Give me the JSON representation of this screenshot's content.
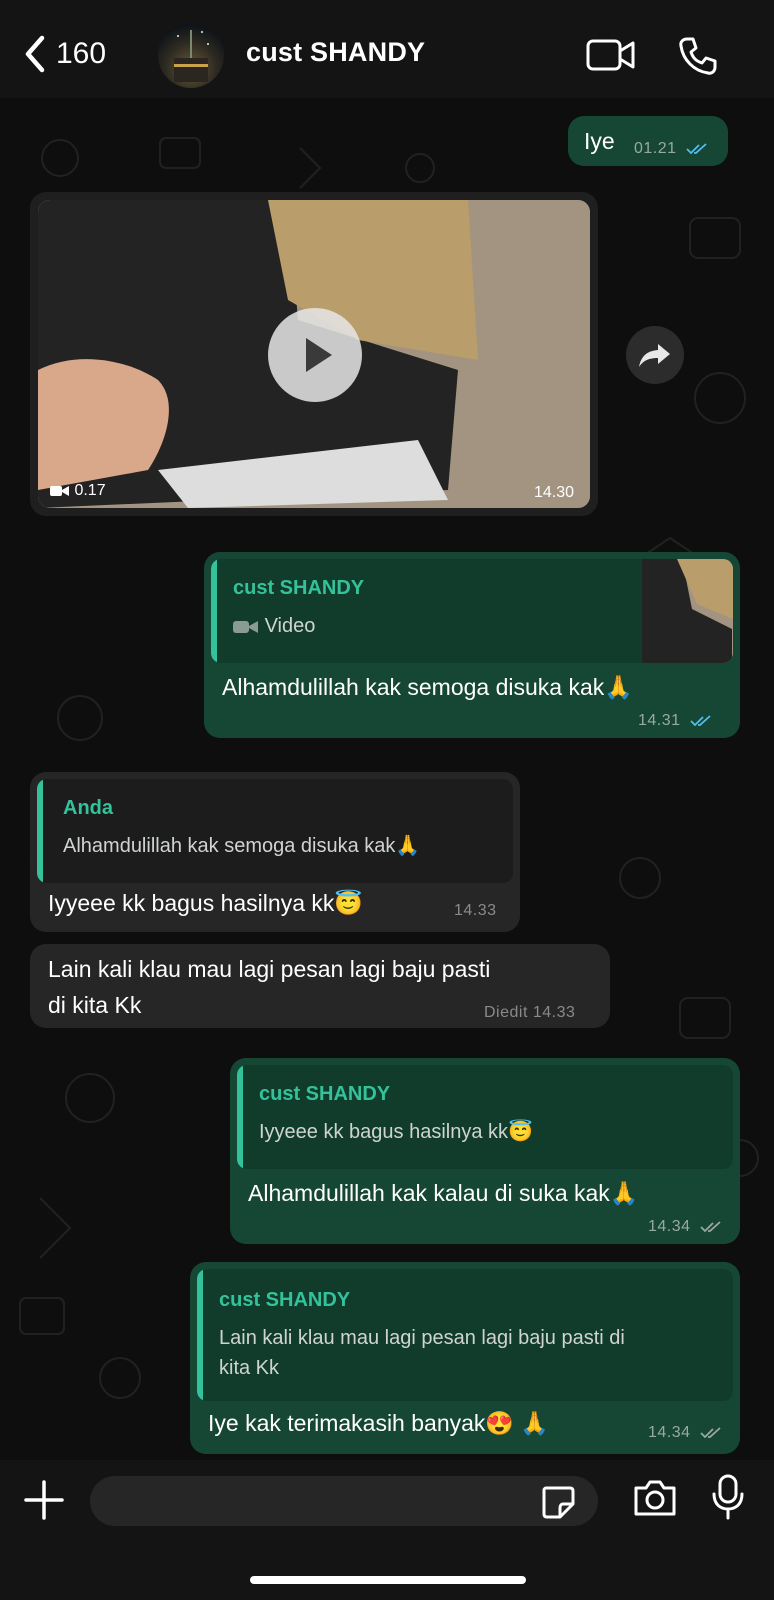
{
  "header": {
    "back_count": "160",
    "contact_name": "cust SHANDY",
    "icons": {
      "back": "chevron-left-icon",
      "video_call": "video-call-icon",
      "voice_call": "phone-icon"
    }
  },
  "messages": [
    {
      "id": "m1",
      "direction": "outgoing",
      "text": "Iye",
      "time": "01.21",
      "status": "read"
    },
    {
      "id": "m2",
      "direction": "incoming",
      "type": "video",
      "duration": "0.17",
      "time": "14.30"
    },
    {
      "id": "m3",
      "direction": "outgoing",
      "quote_name": "cust SHANDY",
      "quote_text": "Video",
      "text": "Alhamdulillah kak semoga disuka kak🙏",
      "time": "14.31",
      "status": "read"
    },
    {
      "id": "m4",
      "direction": "incoming",
      "quote_name": "Anda",
      "quote_text": "Alhamdulillah kak semoga disuka kak🙏",
      "text": "Iyyeee kk bagus hasilnya kk😇",
      "time": "14.33"
    },
    {
      "id": "m5",
      "direction": "incoming",
      "text_line1": "Lain kali klau mau lagi pesan lagi baju pasti",
      "text_line2": "di kita Kk",
      "edited_label": "Diedit",
      "time": "14.33"
    },
    {
      "id": "m6",
      "direction": "outgoing",
      "quote_name": "cust SHANDY",
      "quote_text": "Iyyeee kk bagus hasilnya kk😇",
      "text": "Alhamdulillah kak kalau di suka kak🙏",
      "time": "14.34",
      "status": "delivered"
    },
    {
      "id": "m7",
      "direction": "outgoing",
      "quote_name": "cust SHANDY",
      "quote_text_line1": "Lain kali klau mau lagi pesan lagi baju pasti di",
      "quote_text_line2": "kita Kk",
      "text": "Iye kak terimakasih banyak😍 🙏",
      "time": "14.34",
      "status": "delivered"
    }
  ],
  "composer": {
    "icons": {
      "attach": "plus-icon",
      "sticker": "sticker-icon",
      "camera": "camera-icon",
      "mic": "microphone-icon"
    }
  },
  "colors": {
    "outgoing_bubble": "#154734",
    "incoming_bubble": "#262626",
    "quote_name_accent": "#34c29a",
    "read_ticks": "#53bdeb"
  }
}
